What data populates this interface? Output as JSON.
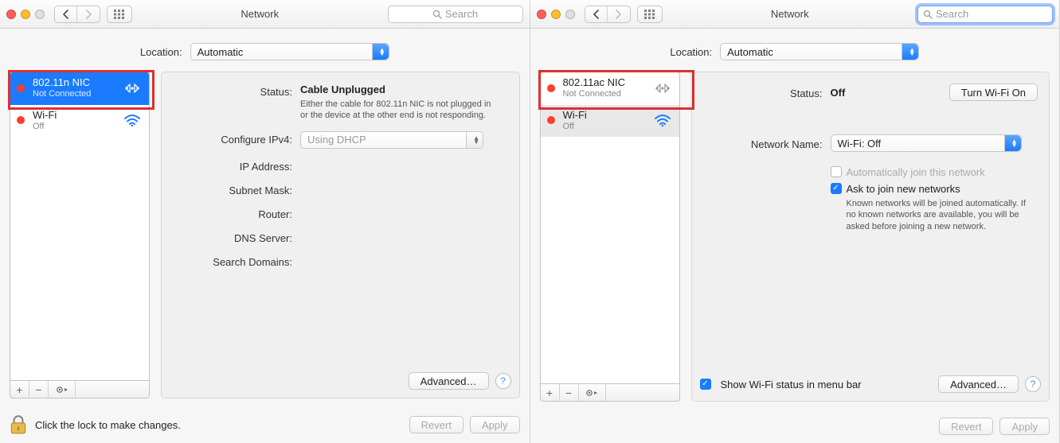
{
  "left": {
    "title": "Network",
    "search_placeholder": "Search",
    "location_label": "Location:",
    "location_value": "Automatic",
    "services": [
      {
        "name": "802.11n NIC",
        "status": "Not Connected",
        "selected": true,
        "kind": "ethernet"
      },
      {
        "name": "Wi-Fi",
        "status": "Off",
        "selected": false,
        "kind": "wifi"
      }
    ],
    "form": {
      "status_label": "Status:",
      "status_value": "Cable Unplugged",
      "status_desc": "Either the cable for 802.11n NIC is not plugged in or the device at the other end is not responding.",
      "configure_label": "Configure IPv4:",
      "configure_value": "Using DHCP",
      "ip_label": "IP Address:",
      "subnet_label": "Subnet Mask:",
      "router_label": "Router:",
      "dns_label": "DNS Server:",
      "search_domains_label": "Search Domains:"
    },
    "advanced_label": "Advanced…",
    "lock_text": "Click the lock to make changes.",
    "revert_label": "Revert",
    "apply_label": "Apply"
  },
  "right": {
    "title": "Network",
    "search_placeholder": "Search",
    "location_label": "Location:",
    "location_value": "Automatic",
    "services": [
      {
        "name": "802.11ac NIC",
        "status": "Not Connected",
        "selected": false,
        "kind": "ethernet"
      },
      {
        "name": "Wi-Fi",
        "status": "Off",
        "selected": true,
        "kind": "wifi"
      }
    ],
    "form": {
      "status_label": "Status:",
      "status_value": "Off",
      "turn_on_label": "Turn Wi-Fi On",
      "network_name_label": "Network Name:",
      "network_name_value": "Wi-Fi: Off",
      "auto_join_label": "Automatically join this network",
      "ask_label": "Ask to join new networks",
      "ask_desc": "Known networks will be joined automatically. If no known networks are available, you will be asked before joining a new network.",
      "show_status_label": "Show Wi-Fi status in menu bar"
    },
    "advanced_label": "Advanced…",
    "revert_label": "Revert",
    "apply_label": "Apply"
  }
}
